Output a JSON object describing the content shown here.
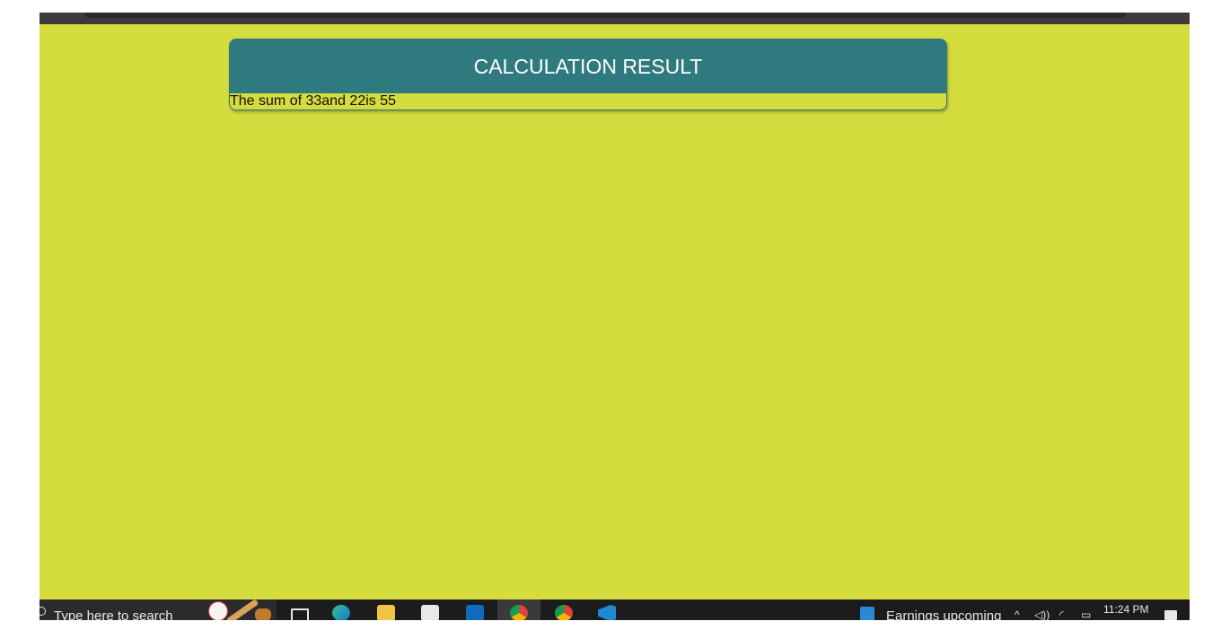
{
  "page": {
    "card_title": "CALCULATION RESULT",
    "result_text": "The sum of 33and 22is 55"
  },
  "taskbar": {
    "search_placeholder": "Type here to search",
    "news_text": "Earnings upcoming",
    "clock_time": "11:24 PM",
    "icons": [
      "search-icon",
      "baseball-icon",
      "task-view-icon",
      "edge-icon",
      "file-explorer-icon",
      "store-icon",
      "outlook-icon",
      "chrome-icon",
      "chrome-icon",
      "vscode-icon",
      "news-icon",
      "chevron-up-icon",
      "volume-icon",
      "wifi-icon",
      "battery-icon",
      "notification-icon"
    ]
  },
  "colors": {
    "page_background": "#d4dc3e",
    "card_header": "#2f7a7e",
    "taskbar": "#1c1c1c"
  }
}
